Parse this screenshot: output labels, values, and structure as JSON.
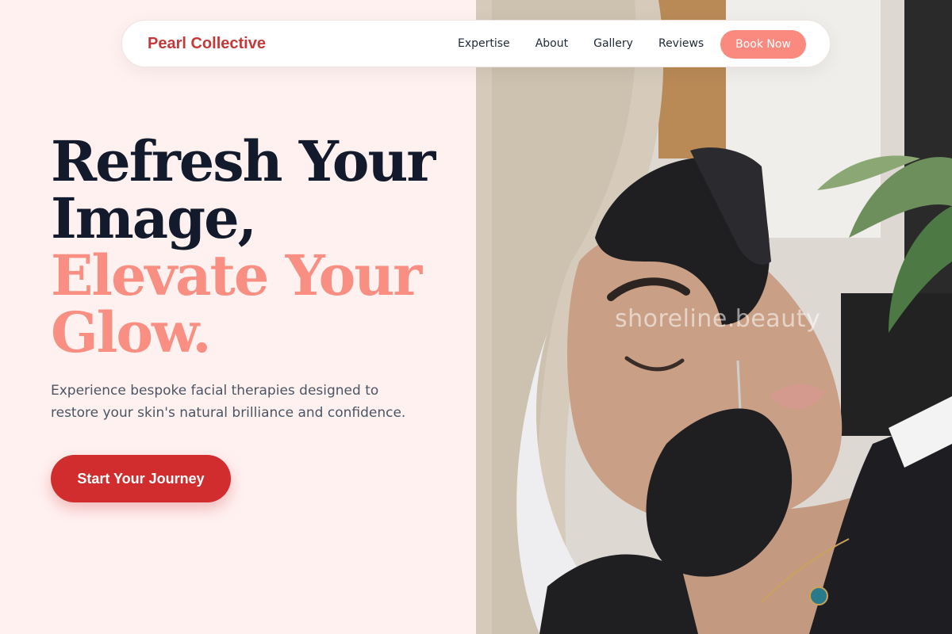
{
  "nav": {
    "brand": "Pearl Collective",
    "links": [
      "Expertise",
      "About",
      "Gallery",
      "Reviews"
    ],
    "cta": "Book Now"
  },
  "hero": {
    "headline_line1": "Refresh Your",
    "headline_line2": "Image,",
    "headline_line3": "Elevate Your",
    "headline_line4": "Glow.",
    "subtitle": "Experience bespoke facial therapies designed to restore your skin's natural brilliance and confidence.",
    "cta": "Start Your Journey"
  },
  "image": {
    "watermark": "shoreline.beauty",
    "description_icon": "facial-treatment-photo"
  },
  "colors": {
    "brand": "#c43a3a",
    "accent": "#fa8a80",
    "cta": "#d12c2e",
    "headline_dark": "#131a2b",
    "headline_accent": "#f98f82",
    "background": "#fff1f0"
  }
}
